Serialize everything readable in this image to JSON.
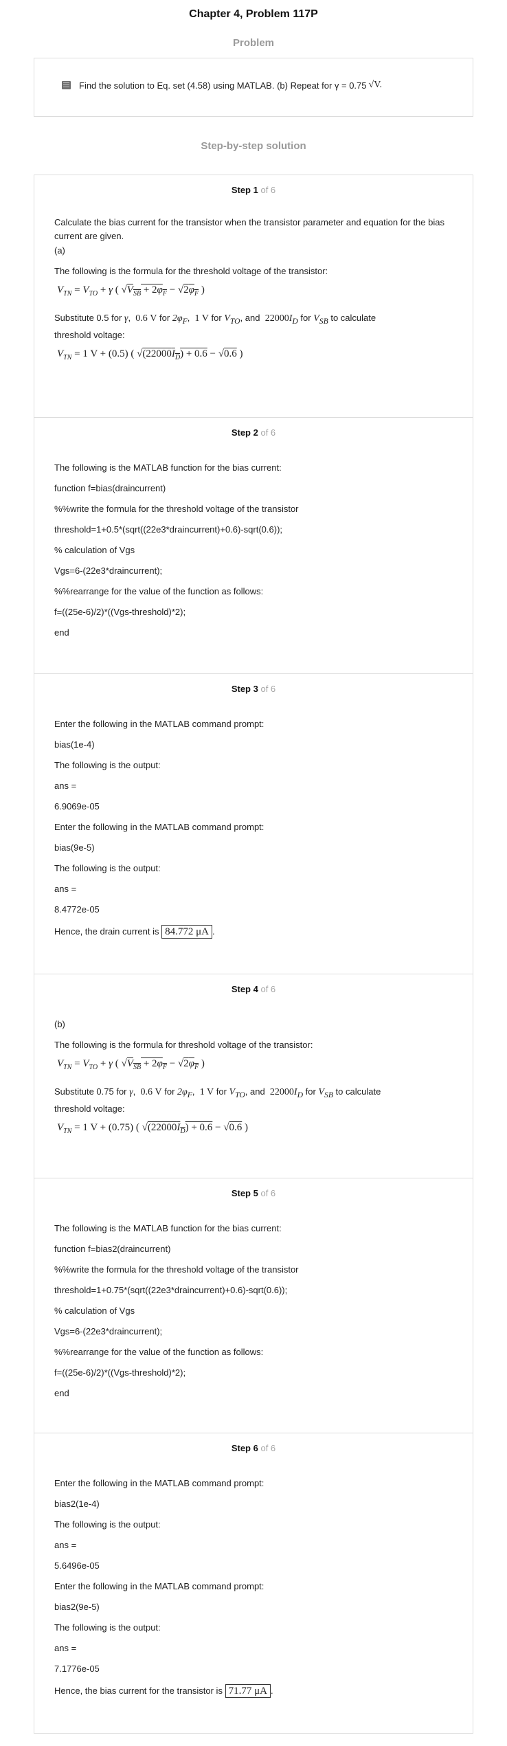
{
  "header": {
    "title": "Chapter 4, Problem 117P",
    "problem_label": "Problem",
    "solution_label": "Step-by-step solution"
  },
  "problem": {
    "text": "Find the solution to Eq. set (4.58) using MATLAB. (b) Repeat for γ = 0.75 ",
    "unit": "√V."
  },
  "steps": [
    {
      "num": "Step 1",
      "of": "of 6",
      "intro": "Calculate the bias current for the transistor when the transistor parameter and equation for the bias current are given.",
      "part": "(a)",
      "formula_intro": "The following is the formula for the threshold voltage of the transistor:",
      "subst_a": "Substitute 0.5 for ",
      "subst_b": "threshold voltage:"
    },
    {
      "num": "Step 2",
      "of": "of 6",
      "lines": [
        "The following is the MATLAB function for the bias current:",
        "function f=bias(draincurrent)",
        "%%write the formula for the threshold voltage of the transistor",
        "threshold=1+0.5*(sqrt((22e3*draincurrent)+0.6)-sqrt(0.6));",
        "% calculation of Vgs",
        "Vgs=6-(22e3*draincurrent);",
        "%%rearrange for the value of the function as follows:",
        "f=((25e-6)/2)*((Vgs-threshold)*2);",
        "end"
      ]
    },
    {
      "num": "Step 3",
      "of": "of 6",
      "lines": [
        "Enter the following in the MATLAB command prompt:",
        "bias(1e-4)",
        "The following is the output:",
        "ans =",
        "6.9069e-05",
        "Enter the following in the MATLAB command prompt:",
        "bias(9e-5)",
        "The following is the output:",
        "ans =",
        "8.4772e-05"
      ],
      "conclusion": "Hence, the drain current is ",
      "answer": "84.772 μA"
    },
    {
      "num": "Step 4",
      "of": "of 6",
      "part": "(b)",
      "formula_intro": "The following is the formula for threshold voltage of the transistor:",
      "subst_a": "Substitute 0.75 for ",
      "subst_b": "threshold voltage:"
    },
    {
      "num": "Step 5",
      "of": "of 6",
      "lines": [
        "The following is the MATLAB function for the bias current:",
        "function f=bias2(draincurrent)",
        "%%write the formula for the threshold voltage of the transistor",
        "threshold=1+0.75*(sqrt((22e3*draincurrent)+0.6)-sqrt(0.6));",
        "% calculation of Vgs",
        "Vgs=6-(22e3*draincurrent);",
        "%%rearrange for the value of the function as follows:",
        "f=((25e-6)/2)*((Vgs-threshold)*2);",
        "end"
      ]
    },
    {
      "num": "Step 6",
      "of": "of 6",
      "lines": [
        "Enter the following in the MATLAB command prompt:",
        "bias2(1e-4)",
        "The following is the output:",
        "ans =",
        "5.6496e-05",
        "Enter the following in the MATLAB command prompt:",
        "bias2(9e-5)",
        "The following is the output:",
        "ans =",
        "7.1776e-05"
      ],
      "conclusion": "Hence, the bias current for the transistor is ",
      "answer": "71.77 μA"
    }
  ]
}
